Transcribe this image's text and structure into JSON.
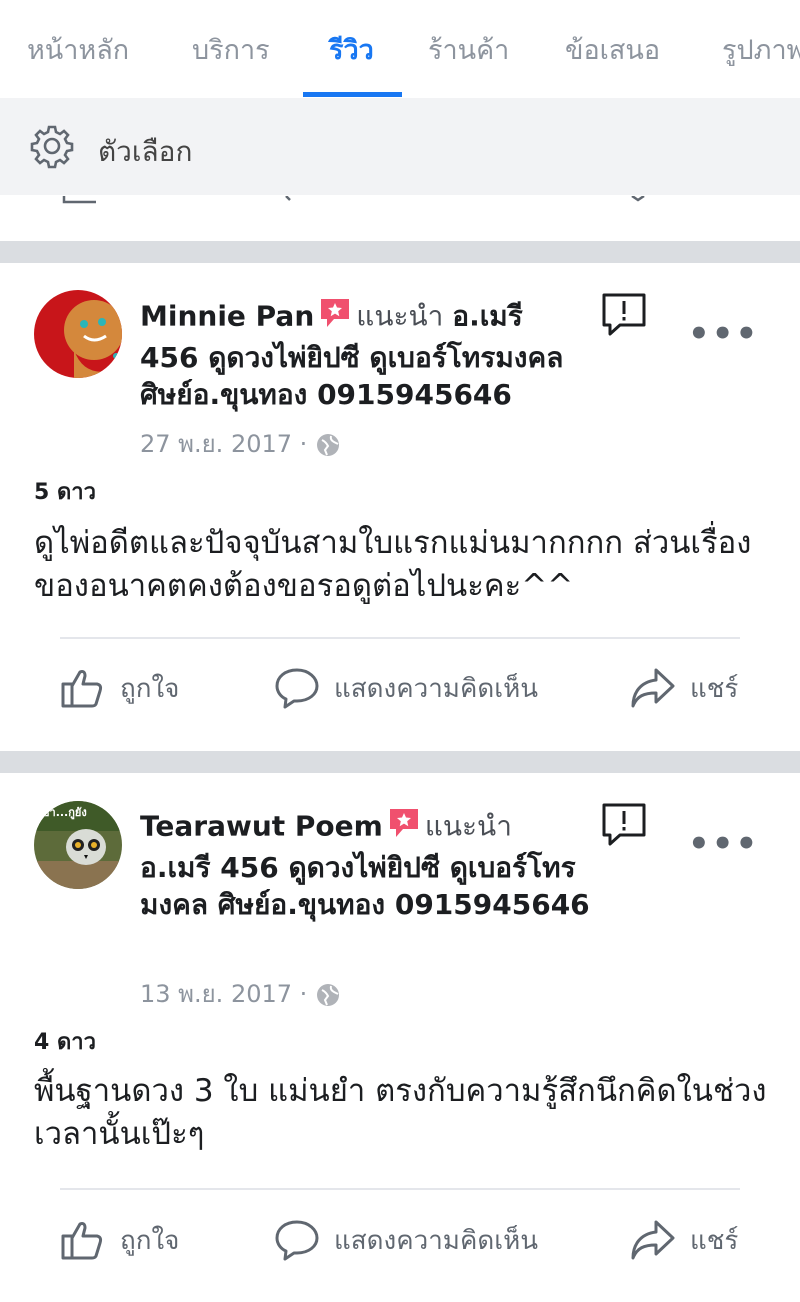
{
  "tabs": [
    {
      "label": "หน้าหลัก",
      "active": false
    },
    {
      "label": "บริการ",
      "active": false
    },
    {
      "label": "รีวิว",
      "active": true
    },
    {
      "label": "ร้านค้า",
      "active": false
    },
    {
      "label": "ข้อเสนอ",
      "active": false
    },
    {
      "label": "รูปภาพ",
      "active": false
    }
  ],
  "options": {
    "label": "ตัวเลือก",
    "icon": "gear-icon"
  },
  "reviews": [
    {
      "name": "Minnie Pan",
      "recommends": "แนะนำ",
      "page": "อ.เมรี 456 ดูดวงไพ่ยิปซี ดูเบอร์โทรมงคล ศิษย์อ.ขุนทอง 0915945646",
      "date": "27 พ.ย. 2017",
      "sep_dot": "·",
      "stars": "5 ดาว",
      "text": "ดูไพ่อดีตและปัจจุบันสามใบแรกแม่นมากกกก ส่วนเรื่องของอนาคตคงต้องขอรอดูต่อไปนะคะ^^",
      "more": "•••"
    },
    {
      "name": "Tearawut Poem",
      "recommends": "แนะนำ",
      "page": "อ.เมรี 456 ดูดวงไพ่ยิปซี ดูเบอร์โทรมงคล ศิษย์อ.ขุนทอง 0915945646",
      "date": "13 พ.ย. 2017",
      "sep_dot": "·",
      "stars": "4 ดาว",
      "text": "พื้นฐานดวง 3 ใบ แม่นยำ ตรงกับความรู้สึกนึกคิดในช่วงเวลานั้นเป๊ะๆ",
      "more": "•••",
      "avatar_caption": "ขา...กูยัง"
    }
  ],
  "actions": {
    "like": "ถูกใจ",
    "comment": "แสดงความคิดเห็น",
    "share": "แชร์"
  },
  "colors": {
    "accent": "#1877f2",
    "badge": "#f0506e",
    "separator": "#dadde1",
    "options_bg": "#f2f3f5"
  }
}
